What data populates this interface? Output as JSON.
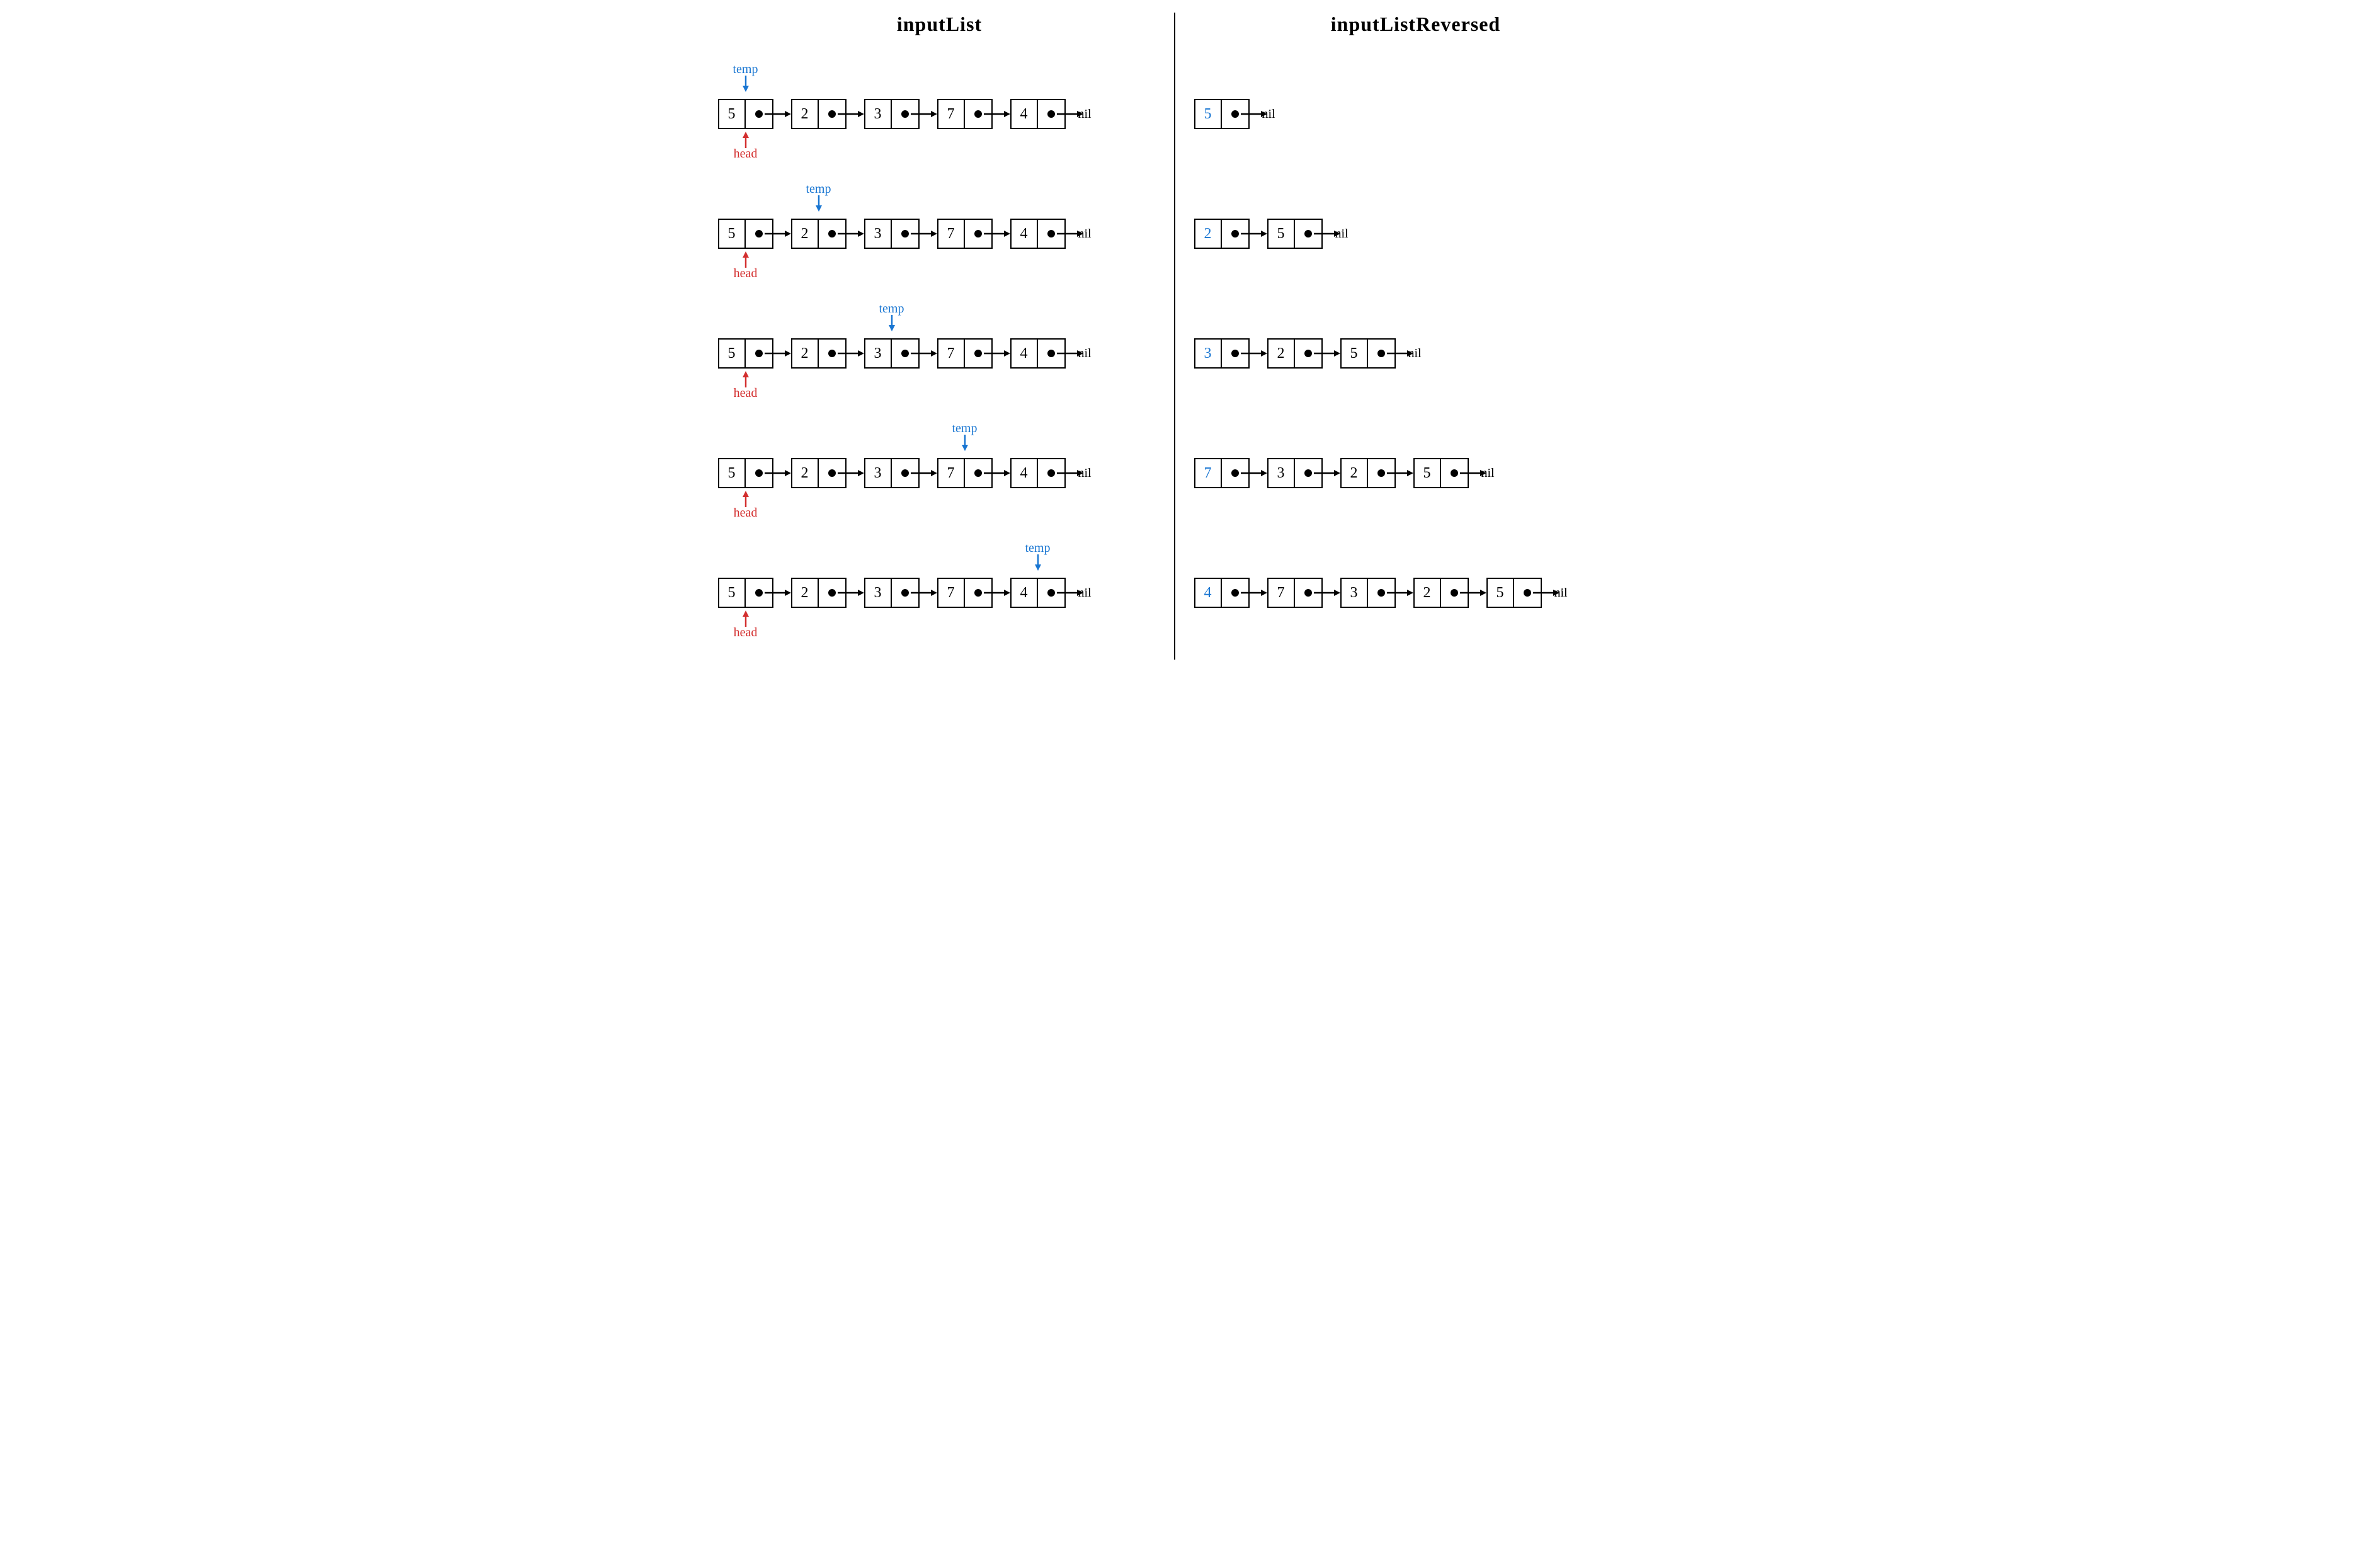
{
  "titles": {
    "left": "inputList",
    "right": "inputListReversed"
  },
  "labels": {
    "temp": "temp",
    "head": "head",
    "nil": "nil"
  },
  "colors": {
    "temp": "#1976d2",
    "head": "#d32f2f",
    "highlight": "#1976d2"
  },
  "inputList": [
    "5",
    "2",
    "3",
    "7",
    "4"
  ],
  "steps": [
    {
      "tempIndex": 0,
      "headIndex": 0,
      "reversed": [
        "5"
      ]
    },
    {
      "tempIndex": 1,
      "headIndex": 0,
      "reversed": [
        "2",
        "5"
      ]
    },
    {
      "tempIndex": 2,
      "headIndex": 0,
      "reversed": [
        "3",
        "2",
        "5"
      ]
    },
    {
      "tempIndex": 3,
      "headIndex": 0,
      "reversed": [
        "7",
        "3",
        "2",
        "5"
      ]
    },
    {
      "tempIndex": 4,
      "headIndex": 0,
      "reversed": [
        "4",
        "7",
        "3",
        "2",
        "5"
      ]
    }
  ],
  "layout": {
    "nodeWidth": 86,
    "arrowWidth": 28,
    "rowTop": 60
  }
}
